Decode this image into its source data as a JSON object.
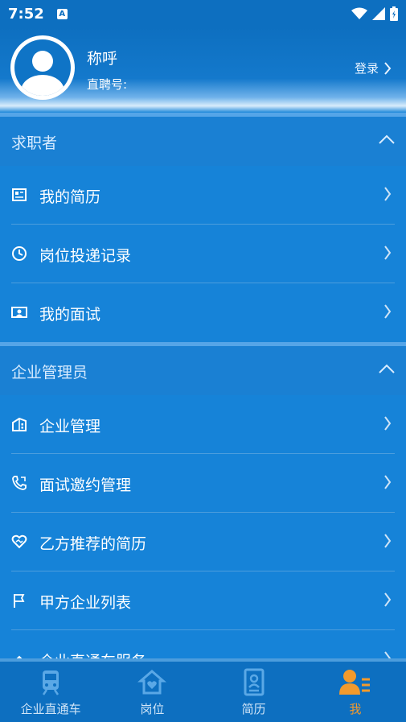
{
  "status": {
    "time": "7:52",
    "notif_letter": "A"
  },
  "profile": {
    "nickname": "称呼",
    "zhipin_label": "直聘号:",
    "login_label": "登录"
  },
  "sections": {
    "seeker": {
      "title": "求职者",
      "items": [
        {
          "label": "我的简历",
          "icon": "resume-icon"
        },
        {
          "label": "岗位投递记录",
          "icon": "clock-icon"
        },
        {
          "label": "我的面试",
          "icon": "interview-icon"
        }
      ]
    },
    "admin": {
      "title": "企业管理员",
      "items": [
        {
          "label": "企业管理",
          "icon": "building-icon"
        },
        {
          "label": "面试邀约管理",
          "icon": "phone-icon"
        },
        {
          "label": "乙方推荐的简历",
          "icon": "heart-icon"
        },
        {
          "label": "甲方企业列表",
          "icon": "flag-icon"
        },
        {
          "label": "企业直通车服务",
          "icon": "partial-icon"
        }
      ]
    }
  },
  "tabs": [
    {
      "label": "企业直通车",
      "icon": "train-icon"
    },
    {
      "label": "岗位",
      "icon": "house-heart-icon"
    },
    {
      "label": "简历",
      "icon": "id-card-icon"
    },
    {
      "label": "我",
      "icon": "user-list-icon",
      "active": true
    }
  ],
  "colors": {
    "primary": "#1683d8",
    "dark": "#0d6fc0",
    "active_tab": "#f39a2c"
  }
}
